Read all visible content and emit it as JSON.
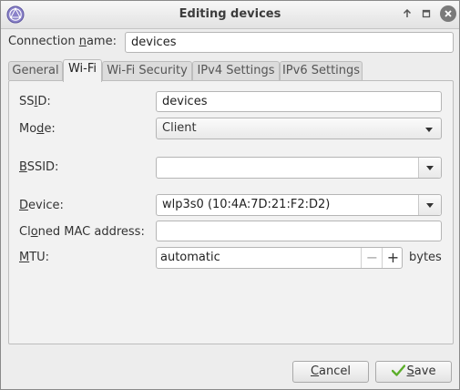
{
  "window": {
    "title": "Editing devices",
    "app_icon": "network-manager-icon",
    "controls": {
      "minimize_icon": "minimize-arrow-icon",
      "maximize_icon": "maximize-icon",
      "close_icon": "close-icon"
    }
  },
  "connection": {
    "label_prefix": "Connection ",
    "label_mnemonic": "n",
    "label_suffix": "ame:",
    "value": "devices"
  },
  "tabs": [
    {
      "label": "General",
      "active": false
    },
    {
      "label": "Wi-Fi",
      "active": true
    },
    {
      "label": "Wi-Fi Security",
      "active": false
    },
    {
      "label": "IPv4 Settings",
      "active": false
    },
    {
      "label": "IPv6 Settings",
      "active": false
    }
  ],
  "wifi": {
    "ssid": {
      "label_prefix": "SS",
      "label_mnemonic": "I",
      "label_suffix": "D:",
      "value": "devices"
    },
    "mode": {
      "label_prefix": "Mo",
      "label_mnemonic": "d",
      "label_suffix": "e:",
      "value": "Client"
    },
    "bssid": {
      "label_prefix": "",
      "label_mnemonic": "B",
      "label_suffix": "SSID:",
      "value": ""
    },
    "device": {
      "label_prefix": "",
      "label_mnemonic": "D",
      "label_suffix": "evice:",
      "value": "wlp3s0 (10:4A:7D:21:F2:D2)"
    },
    "cloned_mac": {
      "label_prefix": "Cl",
      "label_mnemonic": "o",
      "label_suffix": "ned MAC address:",
      "value": ""
    },
    "mtu": {
      "label_prefix": "",
      "label_mnemonic": "M",
      "label_suffix": "TU:",
      "value": "automatic",
      "minus": "−",
      "plus": "+",
      "unit": "bytes"
    }
  },
  "buttons": {
    "cancel": {
      "label_mnemonic": "C",
      "label_suffix": "ancel"
    },
    "save": {
      "label_mnemonic": "S",
      "label_suffix": "ave",
      "icon": "checkmark-icon"
    }
  },
  "colors": {
    "accent_check": "#5cae2a",
    "window_bg": "#ededed"
  }
}
